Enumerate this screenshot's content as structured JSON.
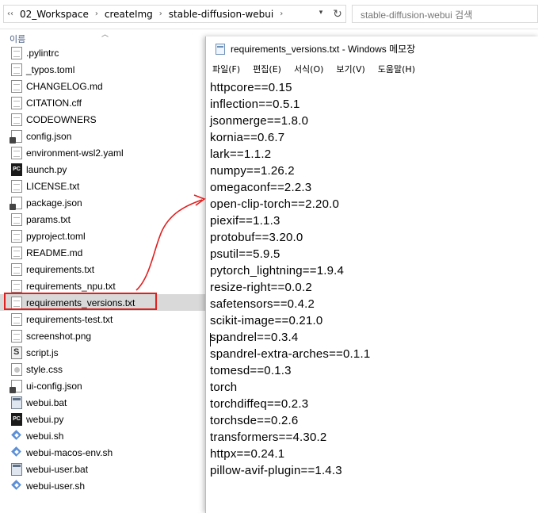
{
  "explorer": {
    "breadcrumb": [
      "02_Workspace",
      "createImg",
      "stable-diffusion-webui"
    ],
    "search_placeholder": "stable-diffusion-webui 검색",
    "column_header": "이름",
    "files": [
      {
        "name": ".pylintrc",
        "icon": "document-icon"
      },
      {
        "name": "_typos.toml",
        "icon": "document-icon"
      },
      {
        "name": "CHANGELOG.md",
        "icon": "document-icon"
      },
      {
        "name": "CITATION.cff",
        "icon": "document-icon"
      },
      {
        "name": "CODEOWNERS",
        "icon": "document-icon"
      },
      {
        "name": "config.json",
        "icon": "json-file-icon"
      },
      {
        "name": "environment-wsl2.yaml",
        "icon": "document-icon"
      },
      {
        "name": "launch.py",
        "icon": "pycharm-file-icon"
      },
      {
        "name": "LICENSE.txt",
        "icon": "document-icon"
      },
      {
        "name": "package.json",
        "icon": "json-file-icon"
      },
      {
        "name": "params.txt",
        "icon": "document-icon"
      },
      {
        "name": "pyproject.toml",
        "icon": "document-icon"
      },
      {
        "name": "README.md",
        "icon": "document-icon"
      },
      {
        "name": "requirements.txt",
        "icon": "document-icon"
      },
      {
        "name": "requirements_npu.txt",
        "icon": "document-icon"
      },
      {
        "name": "requirements_versions.txt",
        "icon": "document-icon",
        "selected": true
      },
      {
        "name": "requirements-test.txt",
        "icon": "document-icon"
      },
      {
        "name": "screenshot.png",
        "icon": "document-icon"
      },
      {
        "name": "script.js",
        "icon": "script-file-icon"
      },
      {
        "name": "style.css",
        "icon": "css-file-icon"
      },
      {
        "name": "ui-config.json",
        "icon": "json-file-icon"
      },
      {
        "name": "webui.bat",
        "icon": "batch-file-icon"
      },
      {
        "name": "webui.py",
        "icon": "pycharm-file-icon"
      },
      {
        "name": "webui.sh",
        "icon": "shell-script-icon"
      },
      {
        "name": "webui-macos-env.sh",
        "icon": "shell-script-icon"
      },
      {
        "name": "webui-user.bat",
        "icon": "batch-file-icon"
      },
      {
        "name": "webui-user.sh",
        "icon": "shell-script-icon"
      }
    ]
  },
  "notepad": {
    "title": "requirements_versions.txt - Windows 메모장",
    "menu": [
      "파일(F)",
      "편집(E)",
      "서식(O)",
      "보기(V)",
      "도움말(H)"
    ],
    "lines": [
      "httpcore==0.15",
      "inflection==0.5.1",
      "jsonmerge==1.8.0",
      "kornia==0.6.7",
      "lark==1.1.2",
      "numpy==1.26.2",
      "omegaconf==2.2.3",
      "open-clip-torch==2.20.0",
      "piexif==1.1.3",
      "protobuf==3.20.0",
      "psutil==5.9.5",
      "pytorch_lightning==1.9.4",
      "resize-right==0.0.2",
      "safetensors==0.4.2",
      "scikit-image==0.21.0",
      "spandrel==0.3.4",
      "spandrel-extra-arches==0.1.1",
      "tomesd==0.1.3",
      "torch",
      "torchdiffeq==0.2.3",
      "torchsde==0.2.6",
      "transformers==4.30.2",
      "httpx==0.24.1",
      "pillow-avif-plugin==1.4.3"
    ]
  },
  "colors": {
    "highlight_box": "#e02020",
    "selection_bg": "#d9d9d9"
  }
}
